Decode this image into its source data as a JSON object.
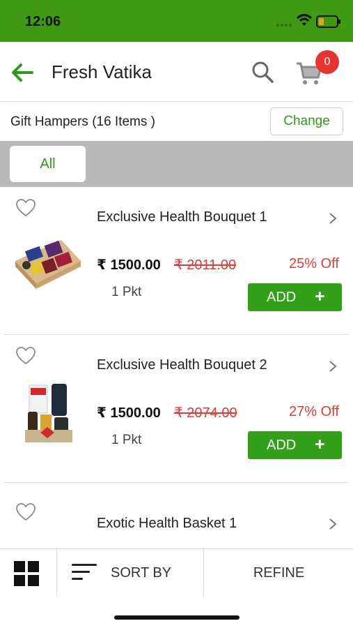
{
  "status": {
    "time": "12:06"
  },
  "header": {
    "title": "Fresh Vatika",
    "cart_count": "0"
  },
  "category": {
    "title": "Gift Hampers (16 Items )",
    "change_label": "Change"
  },
  "filters": {
    "active": "All"
  },
  "products": [
    {
      "name": "Exclusive Health Bouquet 1",
      "price": "₹ 1500.00",
      "mrp": "₹ 2011.00",
      "discount": "25% Off",
      "pack": "1 Pkt",
      "add_label": "ADD",
      "add_icon": "+"
    },
    {
      "name": "Exclusive Health Bouquet 2",
      "price": "₹ 1500.00",
      "mrp": "₹ 2074.00",
      "discount": "27% Off",
      "pack": "1 Pkt",
      "add_label": "ADD",
      "add_icon": "+"
    },
    {
      "name": "Exotic Health Basket 1"
    }
  ],
  "bottom_bar": {
    "sort_label": "SORT BY",
    "refine_label": "REFINE"
  },
  "colors": {
    "brand_green": "#3d9a12",
    "button_green": "#33a01a",
    "sale_red": "#e23a36",
    "badge_red": "#e8332f"
  }
}
